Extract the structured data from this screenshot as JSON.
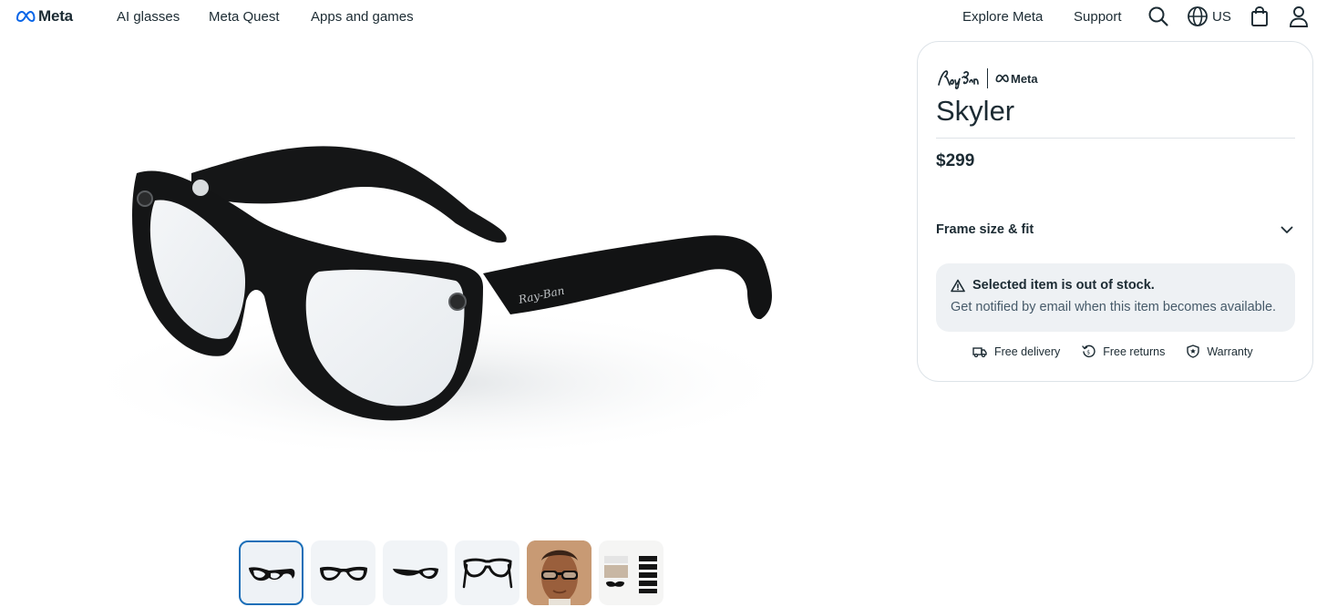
{
  "header": {
    "logo_text": "Meta",
    "nav": [
      "AI glasses",
      "Meta Quest",
      "Apps and games"
    ],
    "right_links": [
      "Explore Meta",
      "Support"
    ],
    "region": "US"
  },
  "product": {
    "brand_partner": "Meta",
    "title": "Skyler",
    "price": "$299",
    "fit_label": "Frame size & fit",
    "stock": {
      "title": "Selected item is out of stock.",
      "description": "Get notified by email when this item becomes available."
    },
    "perks": [
      "Free delivery",
      "Free returns",
      "Warranty"
    ]
  },
  "gallery": {
    "selected_index": 0,
    "thumbnail_count": 6
  },
  "colors": {
    "text": "#1c2b33",
    "accent_border": "#1c6fb8",
    "stock_bg": "#eef1f4"
  }
}
